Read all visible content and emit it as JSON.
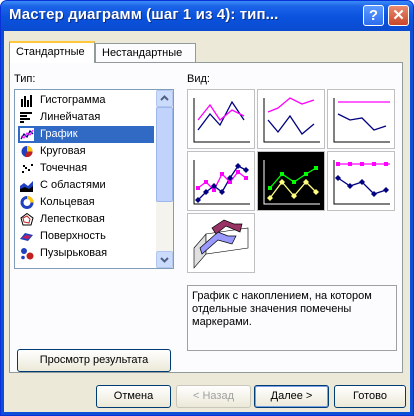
{
  "window": {
    "title": "Мастер диаграмм (шаг 1 из 4): тип..."
  },
  "titlebar": {
    "help_label": "?",
    "close_label": "✕"
  },
  "tabs": [
    {
      "label": "Стандартные",
      "active": true
    },
    {
      "label": "Нестандартные",
      "active": false
    }
  ],
  "type_list": {
    "label": "Тип:",
    "items": [
      {
        "label": "Гистограмма",
        "icon": "column-chart-icon"
      },
      {
        "label": "Линейчатая",
        "icon": "bar-chart-icon"
      },
      {
        "label": "График",
        "icon": "line-chart-icon",
        "selected": true
      },
      {
        "label": "Круговая",
        "icon": "pie-chart-icon"
      },
      {
        "label": "Точечная",
        "icon": "scatter-chart-icon"
      },
      {
        "label": "С областями",
        "icon": "area-chart-icon"
      },
      {
        "label": "Кольцевая",
        "icon": "doughnut-chart-icon"
      },
      {
        "label": "Лепестковая",
        "icon": "radar-chart-icon"
      },
      {
        "label": "Поверхность",
        "icon": "surface-chart-icon"
      },
      {
        "label": "Пузырьковая",
        "icon": "bubble-chart-icon"
      }
    ]
  },
  "view": {
    "label": "Вид:",
    "selected_index": 4,
    "description": "График с накоплением, на котором отдельные значения помечены маркерами."
  },
  "preview_button": "Просмотр результата",
  "footer": {
    "cancel": "Отмена",
    "back": "< Назад",
    "next": "Далее >",
    "finish": "Готово"
  },
  "colors": {
    "title_bar": "#0a52dd",
    "selection": "#316ac5",
    "face": "#ece9d8",
    "magenta": "#ff00ff",
    "navy": "#000080"
  }
}
